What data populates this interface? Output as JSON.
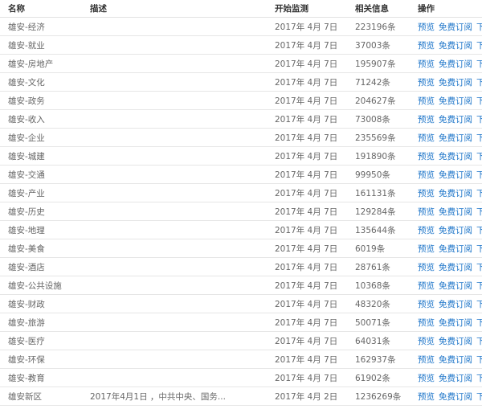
{
  "header": {
    "name": "名称",
    "description": "描述",
    "start": "开始监测",
    "related": "相关信息",
    "actions": "操作"
  },
  "actions": {
    "preview": "预览",
    "subscribe": "免费订阅",
    "download": "下载"
  },
  "rows": [
    {
      "name": "雄安-经济",
      "desc": "",
      "date": "2017年 4月 7日",
      "count": "223196条"
    },
    {
      "name": "雄安-就业",
      "desc": "",
      "date": "2017年 4月 7日",
      "count": "37003条"
    },
    {
      "name": "雄安-房地产",
      "desc": "",
      "date": "2017年 4月 7日",
      "count": "195907条"
    },
    {
      "name": "雄安-文化",
      "desc": "",
      "date": "2017年 4月 7日",
      "count": "71242条"
    },
    {
      "name": "雄安-政务",
      "desc": "",
      "date": "2017年 4月 7日",
      "count": "204627条"
    },
    {
      "name": "雄安-收入",
      "desc": "",
      "date": "2017年 4月 7日",
      "count": "73008条"
    },
    {
      "name": "雄安-企业",
      "desc": "",
      "date": "2017年 4月 7日",
      "count": "235569条"
    },
    {
      "name": "雄安-城建",
      "desc": "",
      "date": "2017年 4月 7日",
      "count": "191890条"
    },
    {
      "name": "雄安-交通",
      "desc": "",
      "date": "2017年 4月 7日",
      "count": "99950条"
    },
    {
      "name": "雄安-产业",
      "desc": "",
      "date": "2017年 4月 7日",
      "count": "161131条"
    },
    {
      "name": "雄安-历史",
      "desc": "",
      "date": "2017年 4月 7日",
      "count": "129284条"
    },
    {
      "name": "雄安-地理",
      "desc": "",
      "date": "2017年 4月 7日",
      "count": "135644条"
    },
    {
      "name": "雄安-美食",
      "desc": "",
      "date": "2017年 4月 7日",
      "count": "6019条"
    },
    {
      "name": "雄安-酒店",
      "desc": "",
      "date": "2017年 4月 7日",
      "count": "28761条"
    },
    {
      "name": "雄安-公共设施",
      "desc": "",
      "date": "2017年 4月 7日",
      "count": "10368条"
    },
    {
      "name": "雄安-财政",
      "desc": "",
      "date": "2017年 4月 7日",
      "count": "48320条"
    },
    {
      "name": "雄安-旅游",
      "desc": "",
      "date": "2017年 4月 7日",
      "count": "50071条"
    },
    {
      "name": "雄安-医疗",
      "desc": "",
      "date": "2017年 4月 7日",
      "count": "64031条"
    },
    {
      "name": "雄安-环保",
      "desc": "",
      "date": "2017年 4月 7日",
      "count": "162937条"
    },
    {
      "name": "雄安-教育",
      "desc": "",
      "date": "2017年 4月 7日",
      "count": "61902条"
    },
    {
      "name": "雄安新区",
      "desc": "2017年4月1日 ，中共中央、国务...",
      "date": "2017年 4月 2日",
      "count": "1236269条"
    }
  ]
}
